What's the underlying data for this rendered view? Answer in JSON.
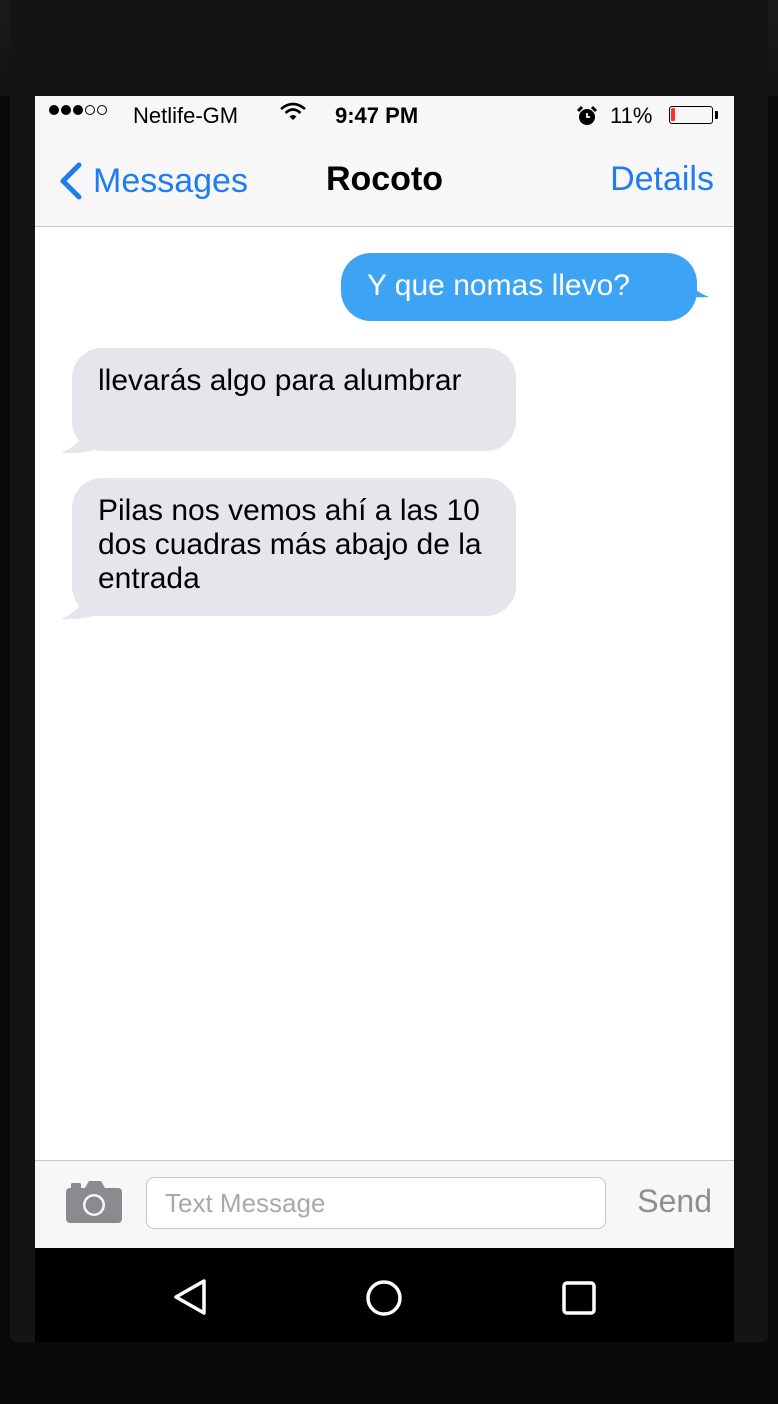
{
  "status_bar": {
    "signal_dots_filled": 3,
    "signal_dots_total": 5,
    "carrier": "Netlife-GM",
    "time": "9:47 PM",
    "battery_percent": "11%",
    "battery_level": 0.11
  },
  "nav": {
    "back_label": "Messages",
    "title": "Rocoto",
    "details_label": "Details"
  },
  "messages": [
    {
      "direction": "sent",
      "text": "Y que nomas llevo?"
    },
    {
      "direction": "received",
      "text": "llevarás algo para alumbrar"
    },
    {
      "direction": "received",
      "text": "Pilas nos vemos ahí a las 10 dos cuadras más abajo de la entrada"
    }
  ],
  "input": {
    "placeholder": "Text Message",
    "value": "",
    "send_label": "Send"
  },
  "colors": {
    "accent": "#1f7cf2",
    "sent_bubble": "#3da3f5",
    "received_bubble": "#e6e5eb",
    "battery_low": "#ff2d2d"
  },
  "icons": {
    "back": "chevron-left-icon",
    "wifi": "wifi-icon",
    "alarm": "alarm-clock-icon",
    "camera": "camera-icon",
    "android_back": "triangle-back-icon",
    "android_home": "circle-home-icon",
    "android_recents": "square-recents-icon"
  }
}
